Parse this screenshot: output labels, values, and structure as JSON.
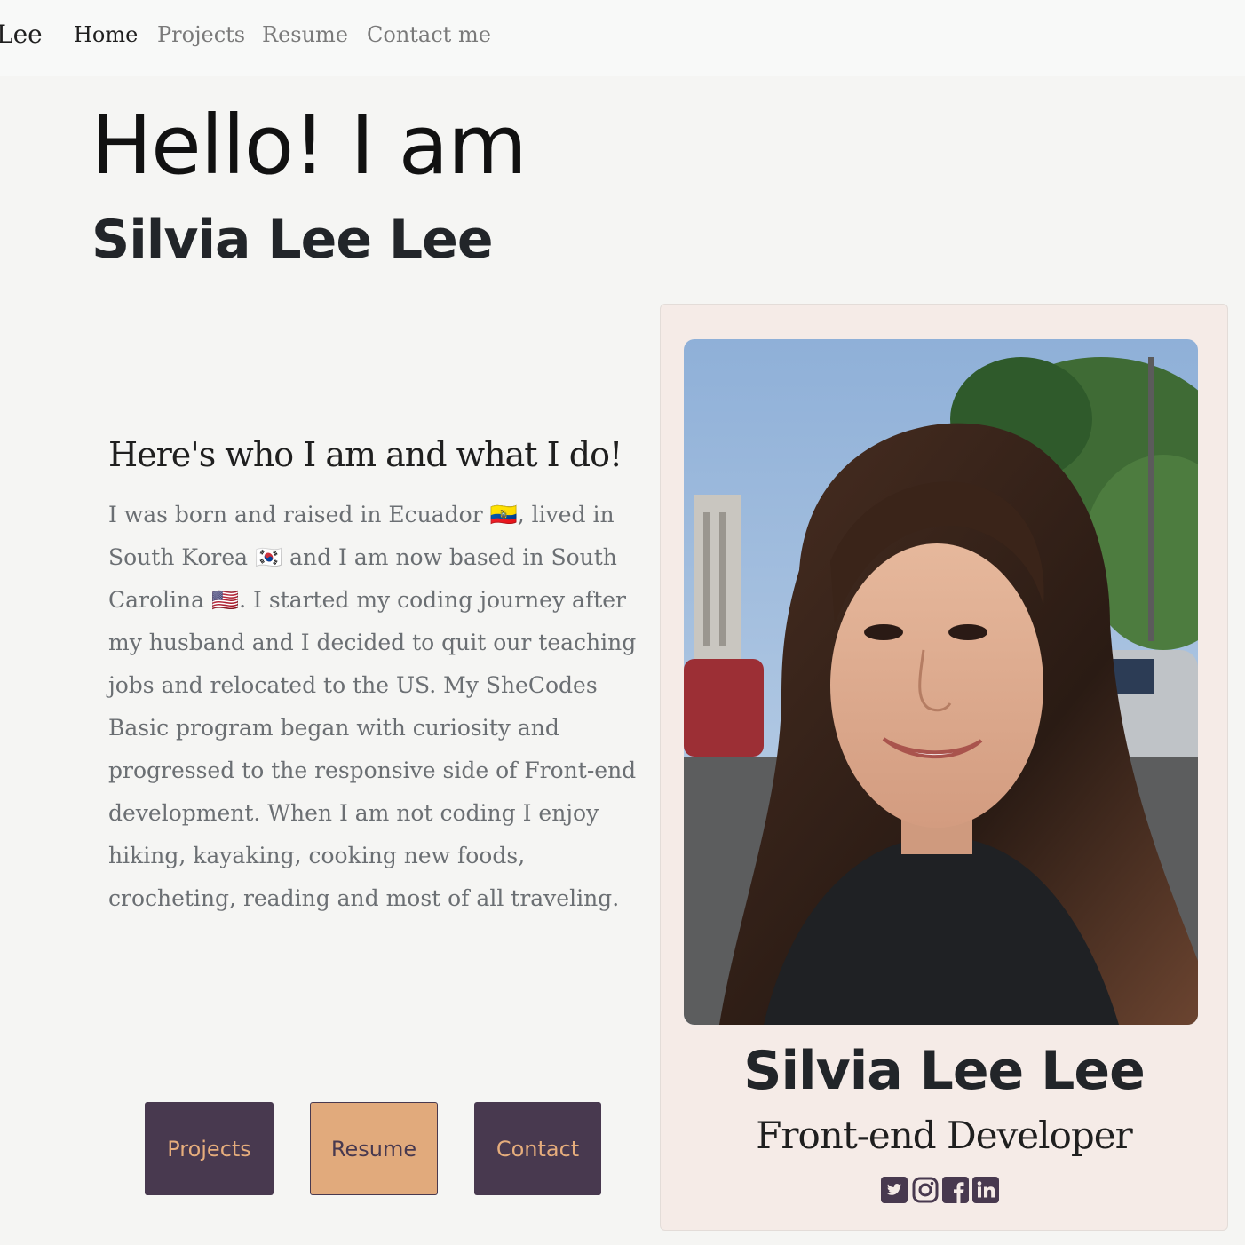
{
  "nav": {
    "brand": "Lee",
    "links": [
      "Home",
      "Projects",
      "Resume",
      "Contact me"
    ]
  },
  "hero": {
    "greeting": "Hello! I am",
    "name": "Silvia Lee Lee"
  },
  "about": {
    "title": "Here's who I am and what I do!",
    "paragraph": "I was born and raised in Ecuador 🇪🇨, lived in South Korea 🇰🇷 and I am now based in South Carolina 🇺🇸. I started my coding journey after my husband and I decided to quit our teaching jobs and relocated to the US. My SheCodes Basic program began with curiosity and progressed to the responsive side of Front-end development. When I am not coding I enjoy hiking, kayaking, cooking new foods, crocheting, reading and most of all traveling."
  },
  "buttons": [
    "Projects",
    "Resume",
    "Contact"
  ],
  "profile_card": {
    "name": "Silvia Lee Lee",
    "role": "Front-end Developer",
    "socials": [
      "twitter-icon",
      "instagram-icon",
      "facebook-icon",
      "linkedin-icon"
    ]
  },
  "colors": {
    "page_bg": "#f5f5f3",
    "navbar_bg": "#f8f9f8",
    "accent_dark": "#48394f",
    "accent_light": "#e1aa7c",
    "card_bg": "#f5ebe7"
  }
}
